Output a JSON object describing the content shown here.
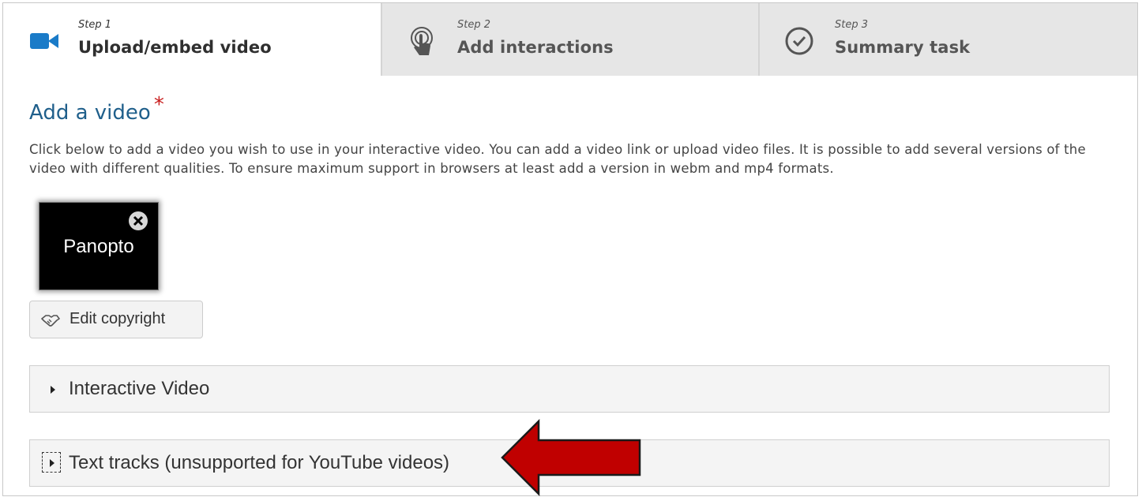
{
  "steps": [
    {
      "number": "Step 1",
      "title": "Upload/embed video",
      "icon": "video-camera-icon",
      "active": true
    },
    {
      "number": "Step 2",
      "title": "Add interactions",
      "icon": "touch-tap-icon",
      "active": false
    },
    {
      "number": "Step 3",
      "title": "Summary task",
      "icon": "check-circle-icon",
      "active": false
    }
  ],
  "section": {
    "heading": "Add a video",
    "required_marker": "*",
    "description": "Click below to add a video you wish to use in your interactive video. You can add a video link or upload video files. It is possible to add several versions of the video with different qualities. To ensure maximum support in browsers at least add a version in webm and mp4 formats."
  },
  "video": {
    "thumbnail_label": "Panopto",
    "remove_icon": "remove-circle-icon"
  },
  "copyright_button": {
    "label": "Edit copyright",
    "icon": "handshake-icon"
  },
  "groups": [
    {
      "label": "Interactive Video",
      "icon": "caret-right-icon"
    },
    {
      "label": "Text tracks (unsupported for YouTube videos)",
      "icon": "caret-right-icon"
    }
  ],
  "colors": {
    "accent_blue": "#1f5f8b",
    "video_icon_blue": "#1a7bc8",
    "required_red": "#c81e1e",
    "callout_arrow_red": "#c00000"
  },
  "annotation": {
    "arrow_icon": "left-arrow-callout-icon"
  }
}
